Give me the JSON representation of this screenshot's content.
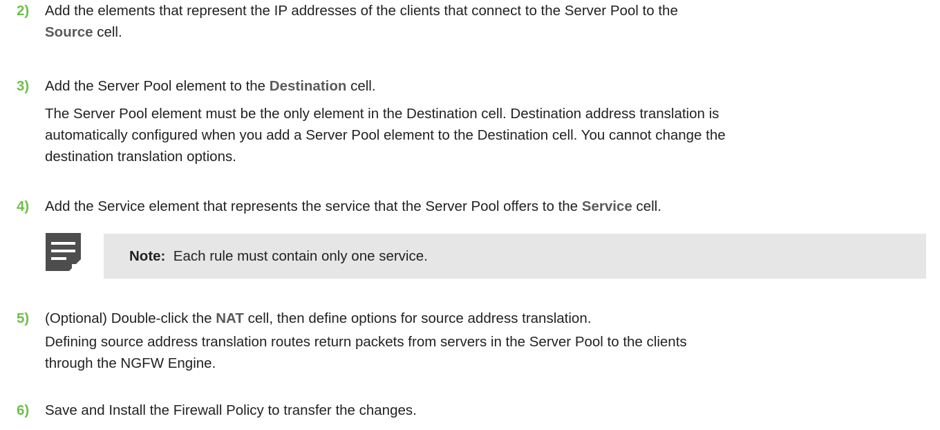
{
  "steps": [
    {
      "number": "2)",
      "line1_pre": "Add the elements that represent the IP addresses of the clients that connect to the Server Pool to the",
      "line2_ui": "Source",
      "line2_post": " cell."
    },
    {
      "number": "3)",
      "line1_pre": "Add the Server Pool element to the ",
      "line1_ui": "Destination",
      "line1_post": " cell.",
      "para_line1": "The Server Pool element must be the only element in the Destination cell. Destination address translation is",
      "para_line2": "automatically configured when you add a Server Pool element to the Destination cell. You cannot change the",
      "para_line3": "destination translation options."
    },
    {
      "number": "4)",
      "line1_pre": "Add the Service element that represents the service that the Server Pool offers to the ",
      "line1_ui": "Service",
      "line1_post": " cell."
    },
    {
      "number": "5)",
      "line1_pre": "(Optional) Double-click the ",
      "line1_ui": "NAT",
      "line1_post": " cell, then define options for source address translation.",
      "para_line1": "Defining source address translation routes return packets from servers in the Server Pool to the clients",
      "para_line2": "through the NGFW Engine."
    },
    {
      "number": "6)",
      "line1_pre": "Save and Install the Firewall Policy to transfer the changes."
    }
  ],
  "note": {
    "label": "Note:",
    "text": "  Each rule must contain only one service.",
    "icon": "note-icon"
  },
  "colors": {
    "step_number": "#6cc04a",
    "ui_term": "#5a5a5a",
    "note_background": "#e6e6e6",
    "note_icon": "#4d4d4d"
  }
}
